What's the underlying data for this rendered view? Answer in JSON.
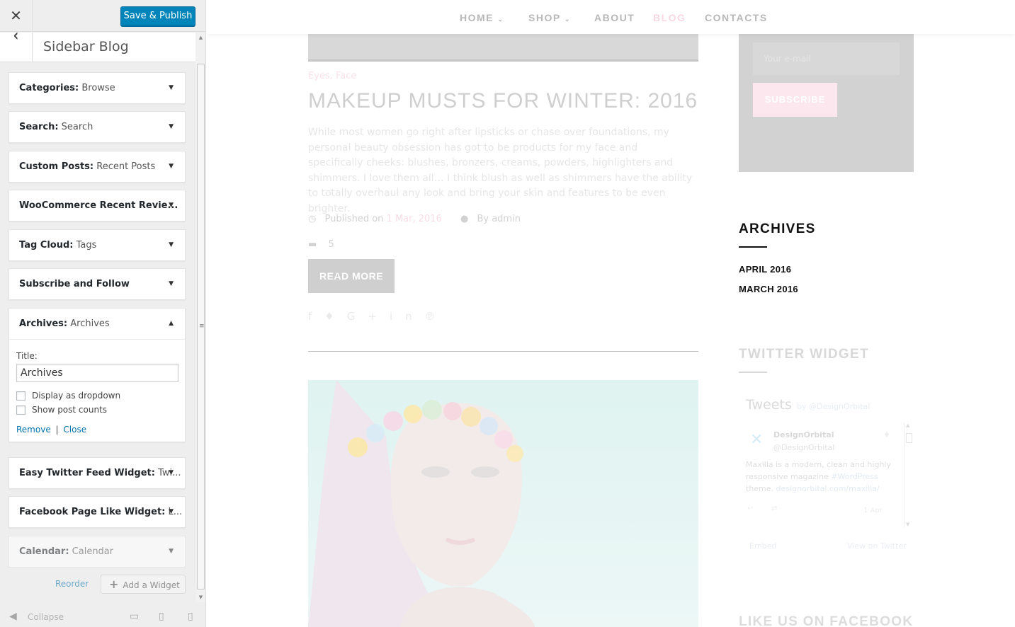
{
  "customizer": {
    "close_icon": "close-icon",
    "publish_label": "Save & Publish",
    "section_title": "Sidebar Blog",
    "widgets": [
      {
        "type": "Categories:",
        "title": " Browse"
      },
      {
        "type": "Search:",
        "title": " Search"
      },
      {
        "type": "Custom Posts:",
        "title": " Recent Posts"
      },
      {
        "type": "WooCommerce Recent Revie...",
        "title": ""
      },
      {
        "type": "Tag Cloud:",
        "title": " Tags"
      },
      {
        "type": "Subscribe and Follow",
        "title": ""
      },
      {
        "type": "Archives:",
        "title": " Archives"
      },
      {
        "type": "Easy Twitter Feed Widget:",
        "title": " Twi..."
      },
      {
        "type": "Facebook Page Like Widget:",
        "title": " L..."
      },
      {
        "type": "Calendar:",
        "title": " Calendar"
      }
    ],
    "archives_form": {
      "title_label": "Title:",
      "title_value": "Archives",
      "dropdown_label": "Display as dropdown",
      "post_counts_label": "Show post counts",
      "remove_label": "Remove",
      "separator": "|",
      "close_label": "Close"
    },
    "reorder_label": "Reorder",
    "add_widget_label": "Add a Widget",
    "collapse_label": "Collapse"
  },
  "preview": {
    "nav": {
      "home": "HOME",
      "shop": "SHOP",
      "about": "ABOUT",
      "blog": "BLOG",
      "contacts": "CONTACTS",
      "active_color": "#f8d7e3"
    },
    "post": {
      "categories": "Eyes, Face",
      "title": "MAKEUP MUSTS FOR WINTER: 2016",
      "excerpt": "While most women go right after lipsticks or chase over foundations, my personal beauty obsession has got to be products for my face and specifically cheeks: blushes, bronzers, creams, powders, highlighters and shimmers. I love them all… I think blush as well as shimmers have the ability to totally overhaul any look and bring your skin and features to be even brighter.",
      "published_prefix": "Published on",
      "published_date": "1 Mar, 2016",
      "author": "By admin",
      "comments": "5",
      "read_more": "READ MORE"
    },
    "sidebar": {
      "email_placeholder": "Your e-mail",
      "subscribe_label": "SUBSCRIBE",
      "archives_title": "ARCHIVES",
      "archive_links": [
        "APRIL 2016",
        "MARCH 2016"
      ],
      "twitter_title": "TWITTER WIDGET",
      "tweets_label": "Tweets",
      "tweets_by": "by @DesignOrbital",
      "tweet_name": "DesignOrbital",
      "tweet_handle": "@DesignOrbital",
      "tweet_text_1": "Maxilla is a modern, clean and highly",
      "tweet_text_2": "responsive magazine",
      "tweet_hashtag": "#WordPress",
      "tweet_text_3": "theme.",
      "tweet_link": "designorbital.com/maxilla/",
      "tweet_date": "1 Apr",
      "embed_label": "Embed",
      "view_on_twitter": "View on Twitter",
      "facebook_title": "LIKE US ON FACEBOOK"
    }
  }
}
